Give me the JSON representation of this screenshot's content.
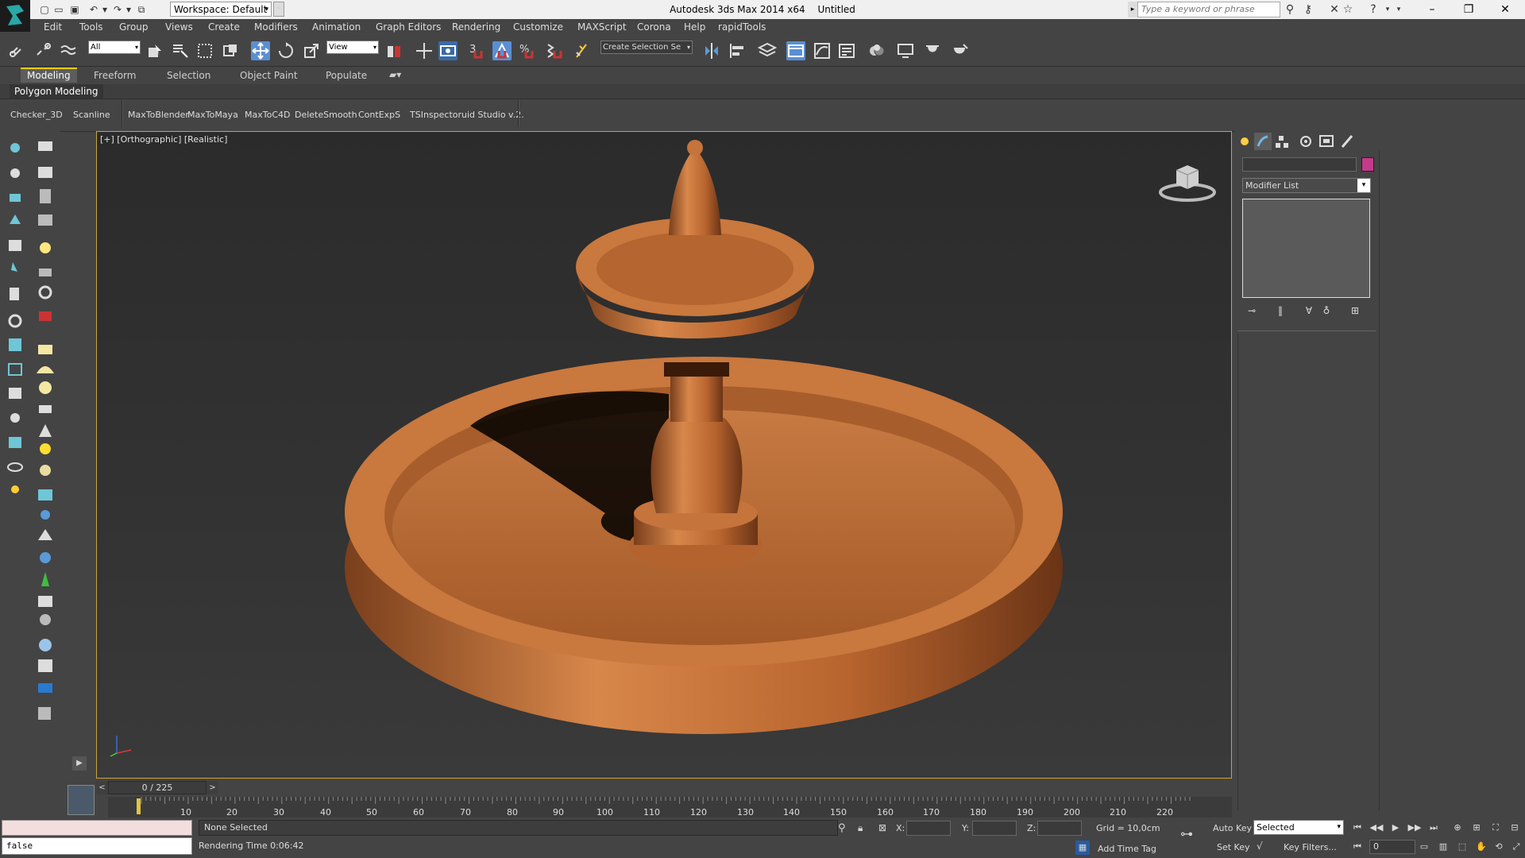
{
  "title_bar": {
    "app_name": "Autodesk 3ds Max  2014 x64",
    "document": "Untitled",
    "workspace": "Workspace: Default",
    "search_placeholder": "Type a keyword or phrase"
  },
  "menu": [
    "Edit",
    "Tools",
    "Group",
    "Views",
    "Create",
    "Modifiers",
    "Animation",
    "Graph Editors",
    "Rendering",
    "Customize",
    "MAXScript",
    "Corona",
    "Help",
    "rapidTools"
  ],
  "main_toolbar": {
    "selection_filter": "All",
    "ref_coord": "View",
    "snap_label": "3",
    "angle_snap_label": "%",
    "selection_set": "Create Selection Se"
  },
  "ribbon": {
    "tabs": [
      "Modeling",
      "Freeform",
      "Selection",
      "Object Paint",
      "Populate"
    ],
    "panel_label": "Polygon Modeling"
  },
  "script_toolbar": [
    "Checker_3D",
    "Scanline",
    "MaxToBlender",
    "MaxToMaya",
    "MaxToC4D",
    "DeleteSmooth",
    "ContExpS",
    "TSInspector",
    "uid Studio v.2."
  ],
  "viewport": {
    "label": "[+] [Orthographic] [Realistic]",
    "model_color": "#c6733c"
  },
  "command_panel": {
    "modifier_list": "Modifier List",
    "object_color": "#c33b8a"
  },
  "timeline": {
    "slider": "0 / 225",
    "ticks": [
      "10",
      "20",
      "30",
      "40",
      "50",
      "60",
      "70",
      "80",
      "90",
      "100",
      "110",
      "120",
      "130",
      "140",
      "150",
      "160",
      "170",
      "180",
      "190",
      "200",
      "210",
      "220"
    ]
  },
  "status": {
    "script_output": "false",
    "selection": "None Selected",
    "render_time": "Rendering Time  0:06:42",
    "x_label": "X:",
    "y_label": "Y:",
    "z_label": "Z:",
    "grid": "Grid = 10,0cm",
    "add_time_tag": "Add Time Tag",
    "auto_key": "Auto Key",
    "set_key": "Set Key",
    "key_mode": "Selected",
    "key_filters": "Key Filters...",
    "frame": "0"
  }
}
